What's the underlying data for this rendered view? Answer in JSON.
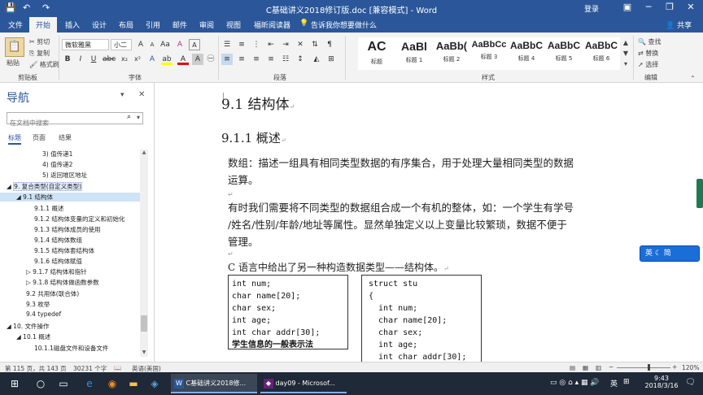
{
  "window": {
    "title": "C基础讲义2018修订版.doc [兼容模式] - Word",
    "login": "登录",
    "quick_access": [
      "💾",
      "↶",
      "↷"
    ]
  },
  "ribbon_tabs": [
    "文件",
    "开始",
    "插入",
    "设计",
    "布局",
    "引用",
    "邮件",
    "审阅",
    "视图",
    "福昕阅读器"
  ],
  "active_tab": "开始",
  "tell_me": "告诉我你想要做什么",
  "share": "共享",
  "clipboard": {
    "paste": "粘贴",
    "cut": "剪切",
    "copy": "复制",
    "format_painter": "格式刷",
    "group_label": "剪贴板"
  },
  "font": {
    "name": "微软雅黑",
    "size": "小二",
    "group_label": "字体"
  },
  "paragraph": {
    "group_label": "段落"
  },
  "styles": {
    "items": [
      {
        "preview": "AC",
        "name": "标题"
      },
      {
        "preview": "AaBl",
        "name": "标题 1"
      },
      {
        "preview": "AaBb(",
        "name": "标题 2"
      },
      {
        "preview": "AaBbCc",
        "name": "标题 3"
      },
      {
        "preview": "AaBbC",
        "name": "标题 4"
      },
      {
        "preview": "AaBbC",
        "name": "标题 5"
      },
      {
        "preview": "AaBbC",
        "name": "标题 6"
      }
    ],
    "group_label": "样式"
  },
  "editing": {
    "find": "查找",
    "replace": "替换",
    "select": "选择",
    "group_label": "编辑"
  },
  "nav": {
    "title": "导航",
    "search_placeholder": "在文档中搜索",
    "tabs": [
      "标题",
      "页面",
      "结果"
    ],
    "items": [
      {
        "text": "3) 值传递1",
        "level": 4
      },
      {
        "text": "4) 值传递2",
        "level": 4
      },
      {
        "text": "5) 返回堆区地址",
        "level": 4
      },
      {
        "text": "9. 复合类型(自定义类型)",
        "level": 1
      },
      {
        "text": "9.1 结构体",
        "level": 2,
        "selected": true
      },
      {
        "text": "9.1.1 概述",
        "level": 3
      },
      {
        "text": "9.1.2 结构体变量的定义和初始化",
        "level": 3
      },
      {
        "text": "9.1.3 结构体成员的使用",
        "level": 3
      },
      {
        "text": "9.1.4 结构体数组",
        "level": 3
      },
      {
        "text": "9.1.5 结构体套结构体",
        "level": 3
      },
      {
        "text": "9.1.6 结构体赋值",
        "level": 3
      },
      {
        "text": "9.1.7 结构体和指针",
        "level": 3
      },
      {
        "text": "9.1.8 结构体做函数参数",
        "level": 3
      },
      {
        "text": "9.2 共用体(联合体)",
        "level": 2
      },
      {
        "text": "9.3 枚举",
        "level": 2
      },
      {
        "text": "9.4 typedef",
        "level": 2
      },
      {
        "text": "10. 文件操作",
        "level": 1
      },
      {
        "text": "10.1 概述",
        "level": 2
      },
      {
        "text": "10.1.1磁盘文件和设备文件",
        "level": 3
      }
    ]
  },
  "document": {
    "h2": "9.1 结构体",
    "h3": "9.1.1 概述",
    "para1": [
      "数组：描述一组具有相同类型数据的有序集合，用于处理大量相同类型的数据",
      "运算。"
    ],
    "para2": [
      "有时我们需要将不同类型的数据组合成一个有机的整体，如：一个学生有学号",
      "/姓名/性别/年龄/地址等属性。显然单独定义以上变量比较繁琐，数据不便于",
      "管理。"
    ],
    "para3": "C 语言中给出了另一种构造数据类型——结构体。",
    "box1": [
      "int num;",
      "char name[20];",
      "char sex;",
      "int age;",
      "int char addr[30];"
    ],
    "box1_caption": "学生信息的一般表示法",
    "box2": [
      "struct stu",
      "{",
      "  int num;",
      "  char name[20];",
      "  char sex;",
      "  int age;",
      "  int char addr[30];"
    ]
  },
  "ime": "英 ☾ 简",
  "status": {
    "page": "第 115 页，共 143 页",
    "words": "30231 个字",
    "language": "英语(美国)",
    "zoom": "120%"
  },
  "taskbar": {
    "apps": [
      "C基础讲义2018修...",
      "day09 - Microsof..."
    ],
    "time": "9:43",
    "date": "2018/3/16",
    "ime": "英"
  }
}
